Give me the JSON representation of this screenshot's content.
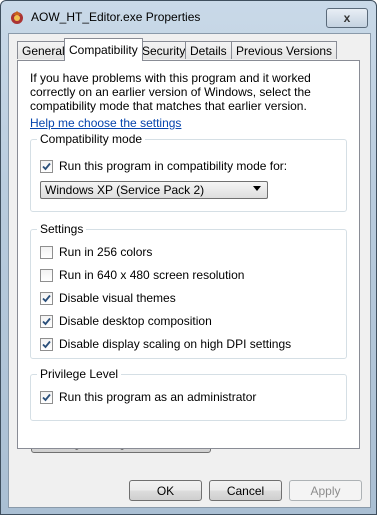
{
  "window": {
    "title": "AOW_HT_Editor.exe Properties",
    "close_glyph": "x"
  },
  "tabs": [
    {
      "label": "General"
    },
    {
      "label": "Compatibility"
    },
    {
      "label": "Security"
    },
    {
      "label": "Details"
    },
    {
      "label": "Previous Versions"
    }
  ],
  "intro_text": "If you have problems with this program and it worked correctly on an earlier version of Windows, select the compatibility mode that matches that earlier version.",
  "help_link": "Help me choose the settings",
  "compat_group": {
    "label": "Compatibility mode",
    "checkbox_label": "Run this program in compatibility mode for:",
    "checked": true,
    "selected_mode": "Windows XP (Service Pack 2)"
  },
  "settings_group": {
    "label": "Settings",
    "items": [
      {
        "label": "Run in 256 colors",
        "checked": false
      },
      {
        "label": "Run in 640 x 480 screen resolution",
        "checked": false
      },
      {
        "label": "Disable visual themes",
        "checked": true
      },
      {
        "label": "Disable desktop composition",
        "checked": true
      },
      {
        "label": "Disable display scaling on high DPI settings",
        "checked": true
      }
    ]
  },
  "privilege_group": {
    "label": "Privilege Level",
    "checkbox_label": "Run this program as an administrator",
    "checked": true
  },
  "change_all_button": "Change settings for all users",
  "buttons": {
    "ok": "OK",
    "cancel": "Cancel",
    "apply": "Apply"
  }
}
